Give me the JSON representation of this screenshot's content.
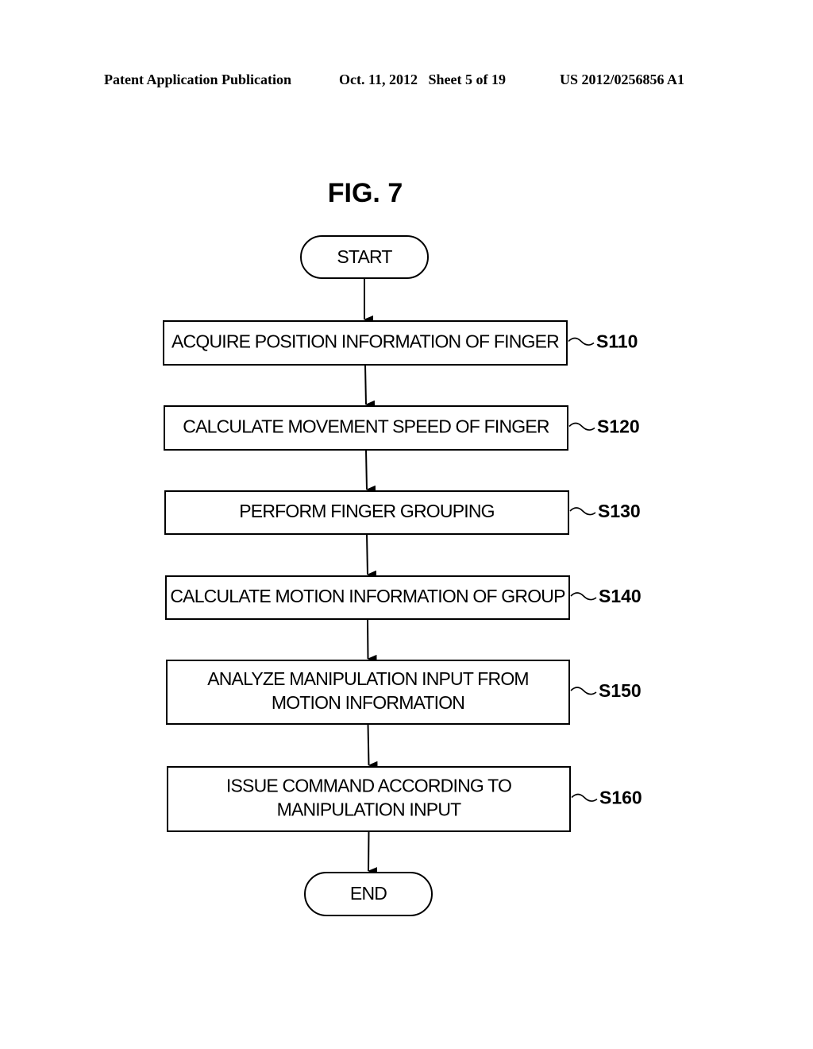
{
  "header": {
    "left": "Patent Application Publication",
    "middle": "Oct. 11, 2012   Sheet 5 of 19",
    "right": "US 2012/0256856 A1"
  },
  "figure": {
    "title": "FIG. 7",
    "start": "START",
    "end": "END",
    "steps": [
      {
        "id": "S110",
        "lines": [
          "ACQUIRE POSITION INFORMATION OF FINGER"
        ]
      },
      {
        "id": "S120",
        "lines": [
          "CALCULATE MOVEMENT SPEED OF FINGER"
        ]
      },
      {
        "id": "S130",
        "lines": [
          "PERFORM FINGER GROUPING"
        ]
      },
      {
        "id": "S140",
        "lines": [
          "CALCULATE MOTION INFORMATION OF GROUP"
        ]
      },
      {
        "id": "S150",
        "lines": [
          "ANALYZE MANIPULATION INPUT FROM",
          "MOTION INFORMATION"
        ]
      },
      {
        "id": "S160",
        "lines": [
          "ISSUE COMMAND ACCORDING TO",
          "MANIPULATION INPUT"
        ]
      }
    ]
  }
}
